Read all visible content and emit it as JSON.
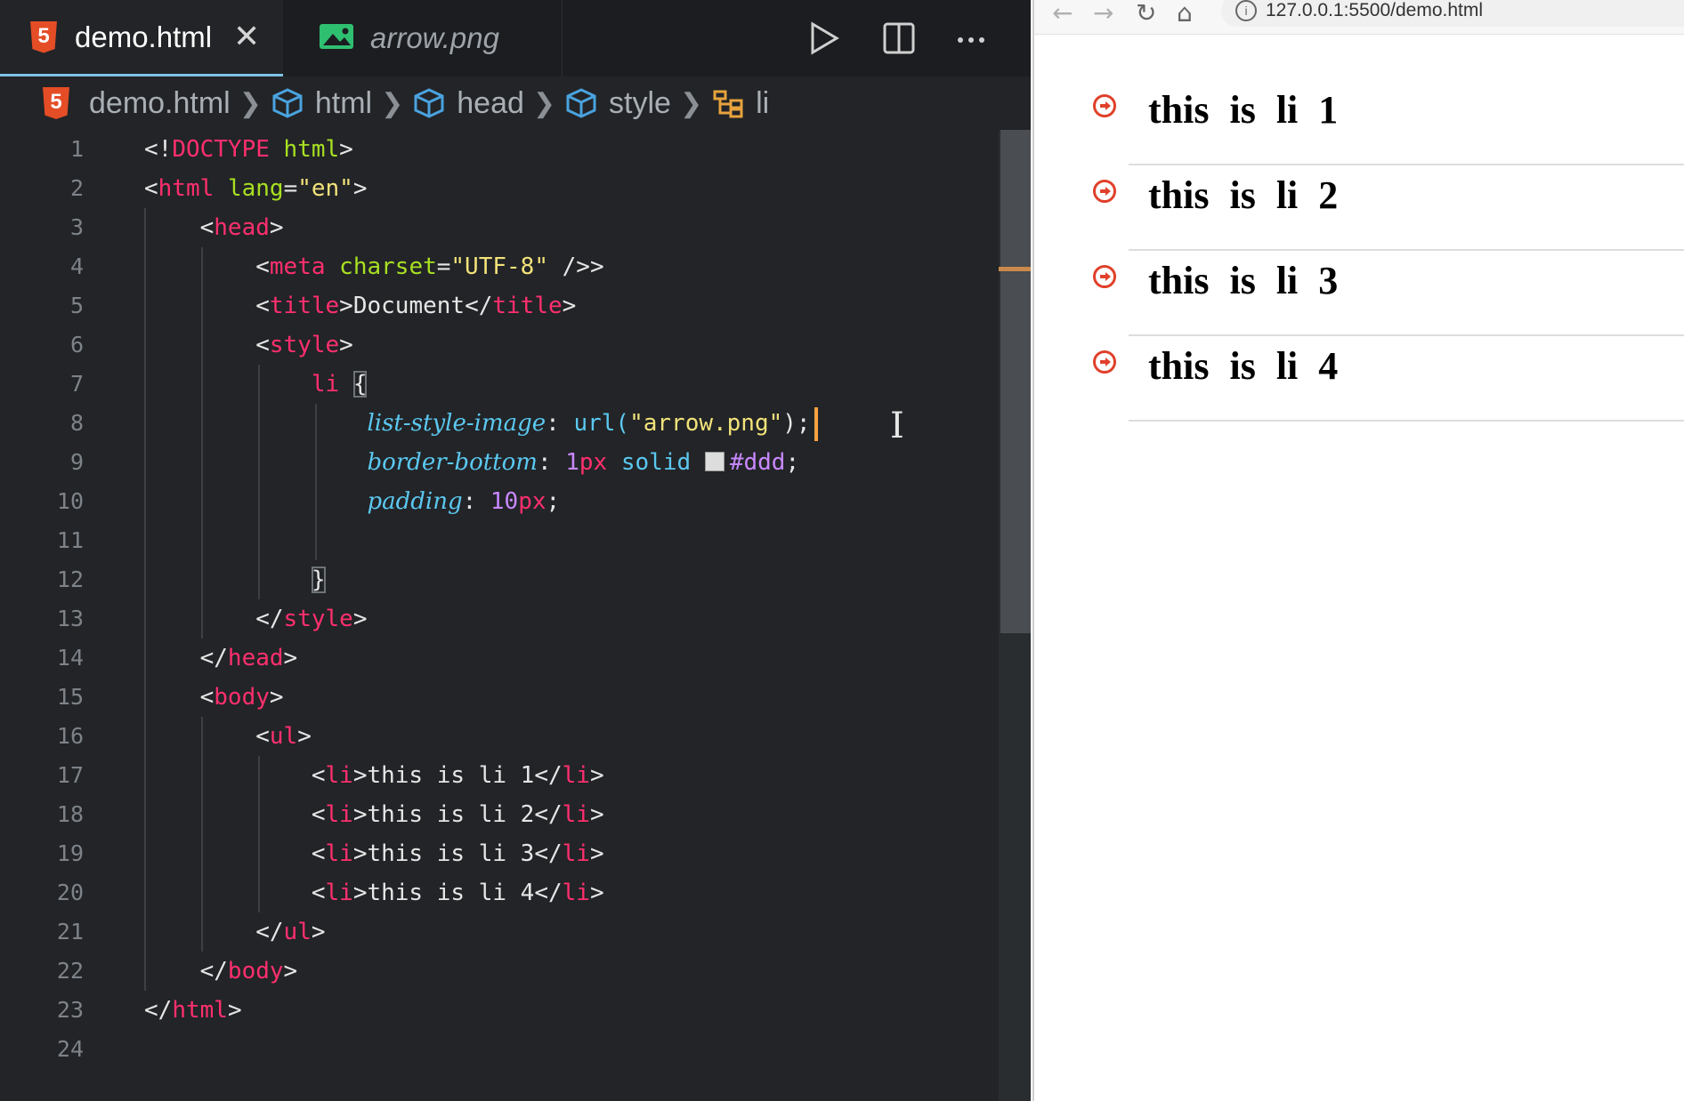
{
  "editor": {
    "tabs": [
      {
        "label": "demo.html",
        "active": true
      },
      {
        "label": "arrow.png",
        "active": false
      }
    ],
    "breadcrumb": [
      "demo.html",
      "html",
      "head",
      "style",
      "li"
    ],
    "line_numbers": [
      "1",
      "2",
      "3",
      "4",
      "5",
      "6",
      "7",
      "8",
      "9",
      "10",
      "11",
      "12",
      "13",
      "14",
      "15",
      "16",
      "17",
      "18",
      "19",
      "20",
      "21",
      "22",
      "23",
      "24"
    ],
    "lines": {
      "l1": {
        "lt": "<!",
        "kw": "DOCTYPE",
        "attr": "html",
        "gt": ">"
      },
      "l2": {
        "tag": "html",
        "attr": "lang",
        "val": "\"en\""
      },
      "l3": {
        "tag": "head"
      },
      "l4": {
        "tag": "meta",
        "attr": "charset",
        "val": "\"UTF-8\"",
        "close": " />"
      },
      "l5": {
        "tag": "title",
        "text": "Document"
      },
      "l6": {
        "tag": "style"
      },
      "l7": {
        "selector": "li",
        "brace": "{"
      },
      "l8": {
        "prop": "list-style-image",
        "fn": "url(",
        "val": "\"arrow.png\"",
        "end": ");"
      },
      "l9": {
        "prop": "border-bottom",
        "num": "1",
        "unit": "px",
        "kw": "solid",
        "color": "#ddd"
      },
      "l10": {
        "prop": "padding",
        "num": "10",
        "unit": "px"
      },
      "l12": {
        "brace": "}"
      },
      "l13": {
        "tag": "style"
      },
      "l14": {
        "tag": "head"
      },
      "l15": {
        "tag": "body"
      },
      "l16": {
        "tag": "ul"
      },
      "l17": {
        "tag": "li",
        "text": "this is li 1"
      },
      "l18": {
        "tag": "li",
        "text": "this is li 2"
      },
      "l19": {
        "tag": "li",
        "text": "this is li 3"
      },
      "l20": {
        "tag": "li",
        "text": "this is li 4"
      },
      "l21": {
        "tag": "ul"
      },
      "l22": {
        "tag": "body"
      },
      "l23": {
        "tag": "html"
      }
    }
  },
  "browser": {
    "url": "127.0.0.1:5500/demo.html",
    "items": [
      "this is li 1",
      "this is li 2",
      "this is li 3",
      "this is li 4"
    ]
  },
  "colors": {
    "tag": "#ff2f6e",
    "attribute": "#a8e022",
    "string": "#f2e27a",
    "property": "#5bc8f0",
    "number": "#c888ff",
    "bullet": "#e0402a"
  }
}
